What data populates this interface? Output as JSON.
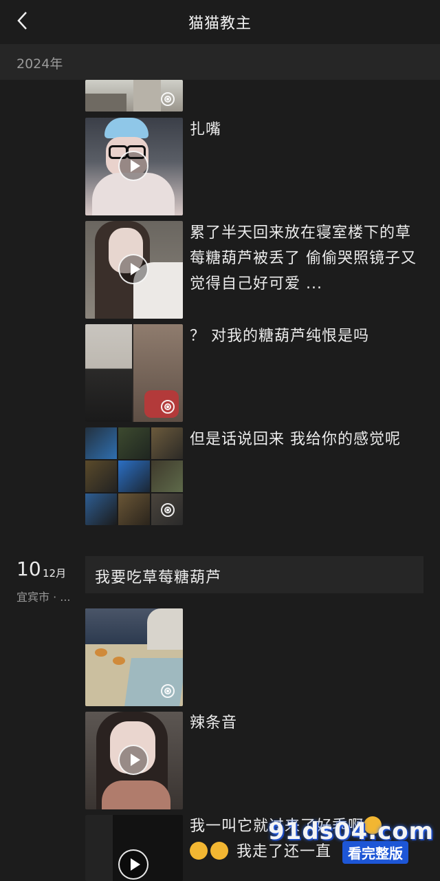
{
  "header": {
    "title": "猫猫教主"
  },
  "year_label": "2024年",
  "posts": [
    {
      "caption": ""
    },
    {
      "caption": "扎嘴"
    },
    {
      "caption": "累了半天回来放在寝室楼下的草莓糖葫芦被丢了 偷偷哭照镜子又觉得自己好可爱 ..."
    },
    {
      "caption": "？ 对我的糖葫芦纯恨是吗"
    },
    {
      "caption": "但是话说回来 我给你的感觉呢"
    }
  ],
  "day_group": {
    "day": "10",
    "month": "12月",
    "location": "宜宾市 · ...",
    "text_post": "我要吃草莓糖葫芦",
    "posts": [
      {
        "caption": ""
      },
      {
        "caption": "辣条音"
      },
      {
        "caption_line1": "我一叫它就过来了好乖啊",
        "caption_line2": "我走了还一直"
      }
    ]
  },
  "watermark": {
    "line1": "91ds04.com",
    "line2": "看完整版"
  },
  "colors": {
    "background": "#1c1c1c",
    "year_bar": "#262626",
    "text": "#ececec",
    "muted": "#9a9a9a"
  }
}
